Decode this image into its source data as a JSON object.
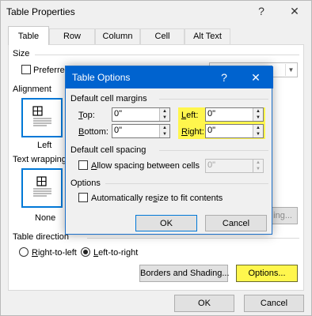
{
  "outer": {
    "title": "Table Properties",
    "help_glyph": "?",
    "close_glyph": "✕",
    "tabs": [
      {
        "label": "Table"
      },
      {
        "label": "Row"
      },
      {
        "label": "Column"
      },
      {
        "label": "Cell"
      },
      {
        "label": "Alt Text"
      }
    ],
    "size_label": "Size",
    "preferred_label": "Preferred",
    "alignment_label": "Alignment",
    "alignment_left_label": "Left",
    "text_wrapping_label": "Text wrapping",
    "wrapping_none_label": "None",
    "positioning_button": "ing...",
    "table_direction_label": "Table direction",
    "rtl_label": "Right-to-left",
    "ltr_label": "Left-to-right",
    "borders_button": "Borders and Shading...",
    "options_button": "Options...",
    "ok_button": "OK",
    "cancel_button": "Cancel"
  },
  "dialog": {
    "title": "Table Options",
    "help_glyph": "?",
    "close_glyph": "✕",
    "margins_group": "Default cell margins",
    "top_label": "Top:",
    "top_value": "0\"",
    "bottom_label": "Bottom:",
    "bottom_value": "0\"",
    "left_label": "Left:",
    "left_value": "0\"",
    "right_label": "Right:",
    "right_value": "0\"",
    "spacing_group": "Default cell spacing",
    "allow_spacing_label": "Allow spacing between cells",
    "spacing_value": "0\"",
    "options_group": "Options",
    "autoresize_label": "Automatically resize to fit contents",
    "ok_button": "OK",
    "cancel_button": "Cancel"
  },
  "colors": {
    "accent": "#0078d7",
    "highlight": "#fff64d",
    "dialog_titlebar": "#0063cf"
  }
}
